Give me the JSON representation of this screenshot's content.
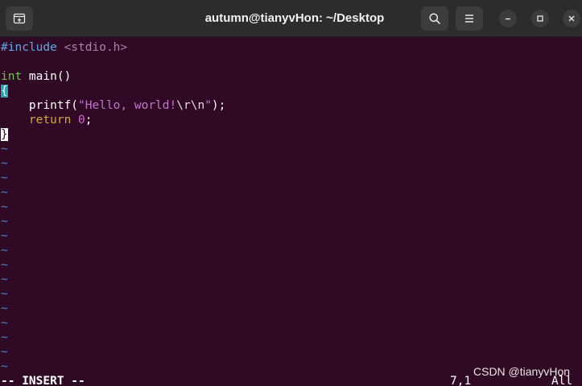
{
  "window": {
    "title": "autumn@tianyvHon: ~/Desktop"
  },
  "titlebar": {
    "new_tab_icon": "new-tab-icon",
    "search_icon": "search-icon",
    "menu_icon": "hamburger-menu-icon",
    "minimize_icon": "minimize-icon",
    "maximize_icon": "maximize-icon",
    "close_icon": "close-icon"
  },
  "editor": {
    "code": {
      "include_directive": "#include",
      "include_file": " <stdio.h>",
      "type_int": "int",
      "main_sig": " main()",
      "open_brace": "{",
      "printf_call": "    printf(",
      "printf_string_part1": "\"Hello, world!",
      "printf_escape_r": "\\r",
      "printf_escape_n": "\\n",
      "printf_string_end": "\"",
      "printf_close": ");",
      "return_indent": "    ",
      "return_keyword": "return",
      "return_space": " ",
      "return_value": "0",
      "return_semicolon": ";",
      "close_brace": "}"
    },
    "tilde": "~"
  },
  "status": {
    "mode": "-- INSERT --",
    "cursor_position": "7,1",
    "scroll": "All"
  },
  "watermark": "CSDN @tianyvHon",
  "colors": {
    "background": "#300a24",
    "titlebar": "#2c2c2c",
    "preprocessor": "#5fa8e8",
    "type": "#6cc24a",
    "string": "#c474d0",
    "keyword": "#d4a93a",
    "tilde": "#4f7fc9"
  }
}
